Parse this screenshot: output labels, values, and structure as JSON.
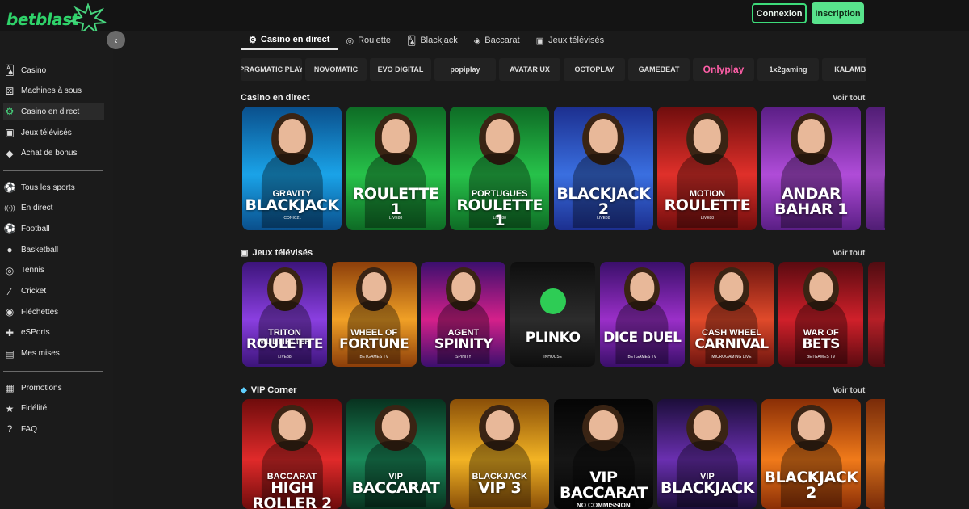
{
  "header": {
    "brand": "betblast",
    "login_label": "Connexion",
    "signup_label": "Inscription"
  },
  "sidebar": {
    "collapse_icon": "chevron-left-icon",
    "group1": [
      {
        "label": "Casino",
        "icon": "cards-icon"
      },
      {
        "label": "Machines à sous",
        "icon": "slot-icon"
      },
      {
        "label": "Casino en direct",
        "icon": "live-casino-icon",
        "active": true
      },
      {
        "label": "Jeux télévisés",
        "icon": "tv-icon"
      },
      {
        "label": "Achat de bonus",
        "icon": "diamond-icon"
      }
    ],
    "group2": [
      {
        "label": "Tous les sports",
        "icon": "sports-icon"
      },
      {
        "label": "En direct",
        "icon": "broadcast-icon"
      },
      {
        "label": "Football",
        "icon": "football-icon"
      },
      {
        "label": "Basketball",
        "icon": "basketball-icon"
      },
      {
        "label": "Tennis",
        "icon": "tennis-icon"
      },
      {
        "label": "Cricket",
        "icon": "cricket-icon"
      },
      {
        "label": "Fléchettes",
        "icon": "darts-icon"
      },
      {
        "label": "eSPorts",
        "icon": "gamepad-icon"
      },
      {
        "label": "Mes mises",
        "icon": "ticket-icon"
      }
    ],
    "group3": [
      {
        "label": "Promotions",
        "icon": "gift-icon"
      },
      {
        "label": "Fidélité",
        "icon": "star-icon"
      },
      {
        "label": "FAQ",
        "icon": "help-icon"
      }
    ]
  },
  "tabs": [
    {
      "label": "Casino en direct",
      "icon": "live-casino-icon",
      "active": true
    },
    {
      "label": "Roulette",
      "icon": "roulette-icon"
    },
    {
      "label": "Blackjack",
      "icon": "cards-icon"
    },
    {
      "label": "Baccarat",
      "icon": "chips-icon"
    },
    {
      "label": "Jeux télévisés",
      "icon": "tv-icon"
    }
  ],
  "providers": [
    "PRAGMATIC PLAY",
    "NOVOMATIC",
    "EVO DIGITAL",
    "popiplay",
    "AVATAR UX",
    "OCTOPLAY",
    "GAMEBEAT",
    "Onlyplay",
    "1x2gaming",
    "KALAMBA"
  ],
  "sections": [
    {
      "title": "Casino en direct",
      "icon": "",
      "see_all": "Voir tout",
      "cards": [
        {
          "line1": "GRAVITY",
          "line2": "BLACKJACK",
          "provider": "ICONIC21",
          "bg1": "#1aa3e8",
          "bg2": "#0a4f8c"
        },
        {
          "line1": "",
          "line2": "ROULETTE 1",
          "provider": "LIVE88",
          "bg1": "#27c24a",
          "bg2": "#0e6b25"
        },
        {
          "line1": "PORTUGUES",
          "line2": "ROULETTE 1",
          "provider": "LIVE88",
          "bg1": "#27c24a",
          "bg2": "#0e6b25"
        },
        {
          "line1": "",
          "line2": "BLACKJACK 2",
          "provider": "LIVE88",
          "bg1": "#3a6fe0",
          "bg2": "#1c2f8f"
        },
        {
          "line1": "MOTION",
          "line2": "ROULETTE",
          "provider": "LIVE88",
          "bg1": "#e0302a",
          "bg2": "#6f0d0d"
        },
        {
          "line1": "",
          "line2": "ANDAR BAHAR 1",
          "provider": "",
          "bg1": "#b04cd8",
          "bg2": "#5a1e85"
        }
      ]
    },
    {
      "title": "Jeux télévisés",
      "icon": "tv-icon",
      "see_all": "Voir tout",
      "cards": [
        {
          "line1": "TRITON MULTIPLIER",
          "line2": "ROULETTE",
          "provider": "LIVE88",
          "bg1": "#8a3fe0",
          "bg2": "#3c147a"
        },
        {
          "line1": "WHEEL OF",
          "line2": "FORTUNE",
          "provider": "BETGAMES TV",
          "bg1": "#f0a026",
          "bg2": "#8c3e0a"
        },
        {
          "line1": "AGENT",
          "line2": "SPINITY",
          "provider": "SPINITY",
          "bg1": "#d4208a",
          "bg2": "#3b0f6e"
        },
        {
          "line1": "",
          "line2": "PLINKO",
          "provider": "INHOUSE",
          "bg1": "#2c2c2c",
          "bg2": "#0e0e0e"
        },
        {
          "line1": "",
          "line2": "DICE DUEL",
          "provider": "BETGAMES TV",
          "bg1": "#9a2fc8",
          "bg2": "#3a0f6a"
        },
        {
          "line1": "CASH WHEEL",
          "line2": "CARNIVAL",
          "provider": "MICROGAMING LIVE",
          "bg1": "#e04a2a",
          "bg2": "#6d140f"
        },
        {
          "line1": "WAR OF",
          "line2": "BETS",
          "provider": "BETGAMES TV",
          "bg1": "#d0202a",
          "bg2": "#5a0a10"
        }
      ]
    },
    {
      "title": "VIP Corner",
      "icon": "diamond-icon",
      "see_all": "Voir tout",
      "cards": [
        {
          "line1": "BACCARAT",
          "line2": "HIGH ROLLER 2",
          "provider": "",
          "bg1": "#e02a2a",
          "bg2": "#6f0c0c"
        },
        {
          "line1": "VIP",
          "line2": "BACCARAT",
          "provider": "",
          "bg1": "#1a8a5a",
          "bg2": "#08321f"
        },
        {
          "line1": "BLACKJACK",
          "line2": "VIP 3",
          "provider": "",
          "bg1": "#f2b324",
          "bg2": "#8a4f08"
        },
        {
          "line1": "",
          "line2": "VIP BACCARAT",
          "provider": "NO COMMISSION",
          "bg1": "#161616",
          "bg2": "#050505"
        },
        {
          "line1": "VIP",
          "line2": "BLACKJACK",
          "provider": "",
          "bg1": "#6a2fb0",
          "bg2": "#1c0e3a"
        },
        {
          "line1": "",
          "line2": "BLACKJACK 2",
          "provider": "",
          "bg1": "#f07a1a",
          "bg2": "#8a2e06"
        }
      ]
    }
  ],
  "colors": {
    "accent": "#3ddc7a",
    "background": "#1a1a1a",
    "sidebar": "#1b1b1b"
  }
}
